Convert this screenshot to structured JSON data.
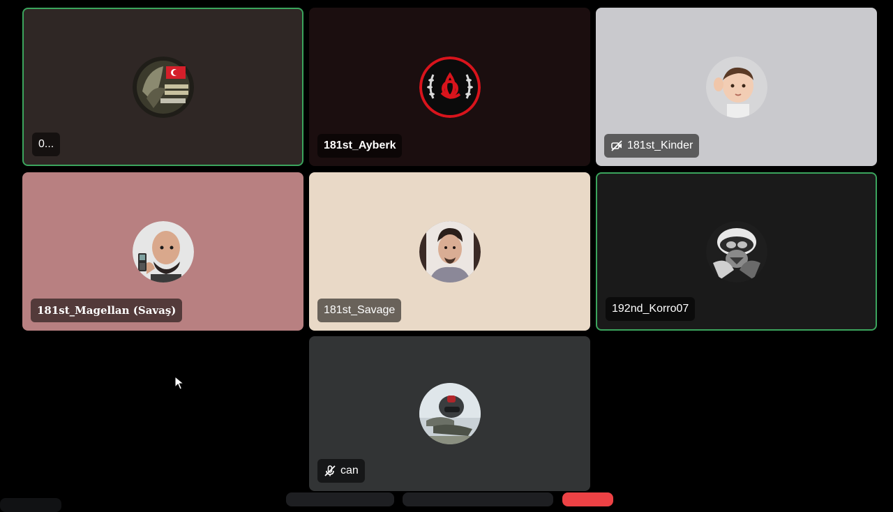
{
  "participants": [
    {
      "name": "0...",
      "speaking": true,
      "muted": false,
      "avatar": "turf-badge-avatar",
      "bg": "#2f2725"
    },
    {
      "name": "181st_Ayberk",
      "speaking": false,
      "muted": false,
      "avatar": "wreath-triquetra-avatar",
      "bg": "#1b0e0f"
    },
    {
      "name": "181st_Kinder",
      "speaking": false,
      "muted": true,
      "avatar": "child-photo-avatar",
      "bg": "#c9c9cd"
    },
    {
      "name": "181st_Magellan (Savaş)",
      "speaking": false,
      "muted": false,
      "avatar": "man-with-phone-avatar",
      "bg": "#b88081"
    },
    {
      "name": "181st_Savage",
      "speaking": false,
      "muted": false,
      "avatar": "young-man-portrait-avatar",
      "bg": "#e9d9c7"
    },
    {
      "name": "192nd_Korro07",
      "speaking": true,
      "muted": false,
      "avatar": "pilot-cat-avatar",
      "bg": "#1a1a1a"
    },
    {
      "name": "can",
      "speaking": false,
      "muted": true,
      "avatar": "fighter-pilot-avatar",
      "bg": "#323435"
    }
  ],
  "colors": {
    "speaking_border": "#3ba55d",
    "page_background": "#000000",
    "leave_button": "#ed4245"
  }
}
